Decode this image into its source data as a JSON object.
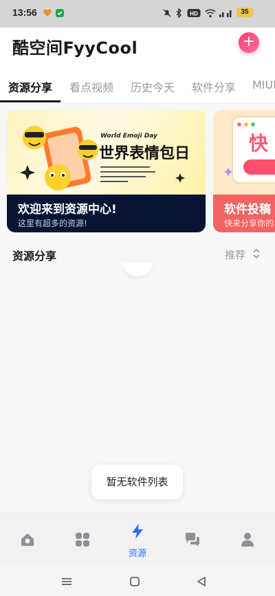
{
  "status_bar": {
    "time": "13:56",
    "battery": "35"
  },
  "header": {
    "title": "酷空间FyyCool",
    "add_button": "+"
  },
  "tabs": [
    {
      "label": "资源分享",
      "active": true
    },
    {
      "label": "看点视频",
      "active": false
    },
    {
      "label": "历史今天",
      "active": false
    },
    {
      "label": "软件分享",
      "active": false
    },
    {
      "label": "MIUI",
      "active": false
    }
  ],
  "banners": [
    {
      "art_heading": "World Emoji Day",
      "art_title": "世界表情包日",
      "title": "欢迎来到资源中心!",
      "subtitle": "这里有超多的资源!"
    },
    {
      "art_title": "快",
      "title": "软件投稿",
      "subtitle": "快来分享你的"
    }
  ],
  "section": {
    "title": "资源分享",
    "sort_label": "推荐"
  },
  "empty_state": "暂无软件列表",
  "bottom_nav": {
    "items": [
      {
        "icon": "home-icon",
        "label": ""
      },
      {
        "icon": "apps-grid-icon",
        "label": ""
      },
      {
        "icon": "lightning-icon",
        "label": "资源",
        "active": true
      },
      {
        "icon": "chat-icon",
        "label": ""
      },
      {
        "icon": "profile-icon",
        "label": ""
      }
    ]
  },
  "colors": {
    "accent": "#2f6bff",
    "add_button": "#ff4d7a",
    "banner_caption": "#071433"
  }
}
